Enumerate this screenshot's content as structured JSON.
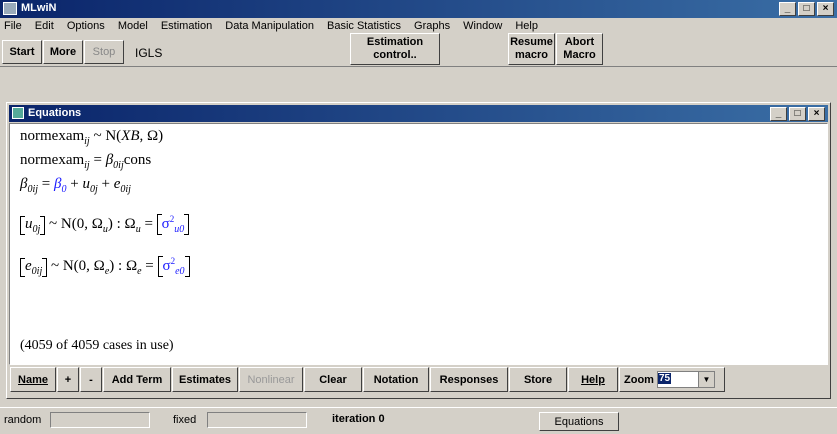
{
  "app": {
    "title": "MLwiN"
  },
  "menu": [
    "File",
    "Edit",
    "Options",
    "Model",
    "Estimation",
    "Data Manipulation",
    "Basic Statistics",
    "Graphs",
    "Window",
    "Help"
  ],
  "toolbar": {
    "start": "Start",
    "more": "More",
    "stop": "Stop",
    "method": "IGLS",
    "estimation_control": [
      "Estimation",
      "control.."
    ],
    "resume_macro": [
      "Resume",
      "macro"
    ],
    "abort_macro": [
      "Abort",
      "Macro"
    ]
  },
  "equations_window": {
    "title": "Equations",
    "line1": {
      "lhs": "normexam",
      "sub": "ij",
      "rhs": " ~ N(",
      "xb": "XB",
      "rest": ", Ω)"
    },
    "line2": {
      "lhs": "normexam",
      "sub": "ij",
      "eq": " = ",
      "beta": "β",
      "beta_sub": "0ij",
      "cons": "cons"
    },
    "line3": {
      "beta": "β",
      "beta_sub": "0ij",
      "eq": " = ",
      "beta0": "β",
      "beta0_sub": "0",
      "plus1": " + ",
      "u": "u",
      "u_sub": "0j",
      "plus2": " + ",
      "e": "e",
      "e_sub": "0ij"
    },
    "line4": {
      "u": "u",
      "u_sub": "0j",
      "dist": "~ N(0,  Ω",
      "dist_sub": "u",
      "close": ") : Ω",
      "omega_sub": "u",
      "eq": " = ",
      "sigma": "σ",
      "sigma_sup": "2",
      "sigma_sub": "u0"
    },
    "line5": {
      "e": "e",
      "e_sub": "0ij",
      "dist": "~ N(0,  Ω",
      "dist_sub": "e",
      "close": ") : Ω",
      "omega_sub": "e",
      "eq": " = ",
      "sigma": "σ",
      "sigma_sup": "2",
      "sigma_sub": "e0"
    },
    "cases": "(4059 of 4059 cases in use)",
    "buttons": [
      "Name",
      "+",
      "-",
      "Add Term",
      "Estimates",
      "Nonlinear",
      "Clear",
      "Notation",
      "Responses",
      "Store",
      "Help"
    ],
    "zoom_label": "Zoom",
    "zoom_value": "75"
  },
  "statusbar": {
    "random_label": "random",
    "fixed_label": "fixed",
    "iteration": "iteration 0",
    "task": "Equations"
  },
  "colors": {
    "titlebar": "#0a246a",
    "accent_blue": "#1a1aff",
    "face": "#d4d0c8"
  }
}
